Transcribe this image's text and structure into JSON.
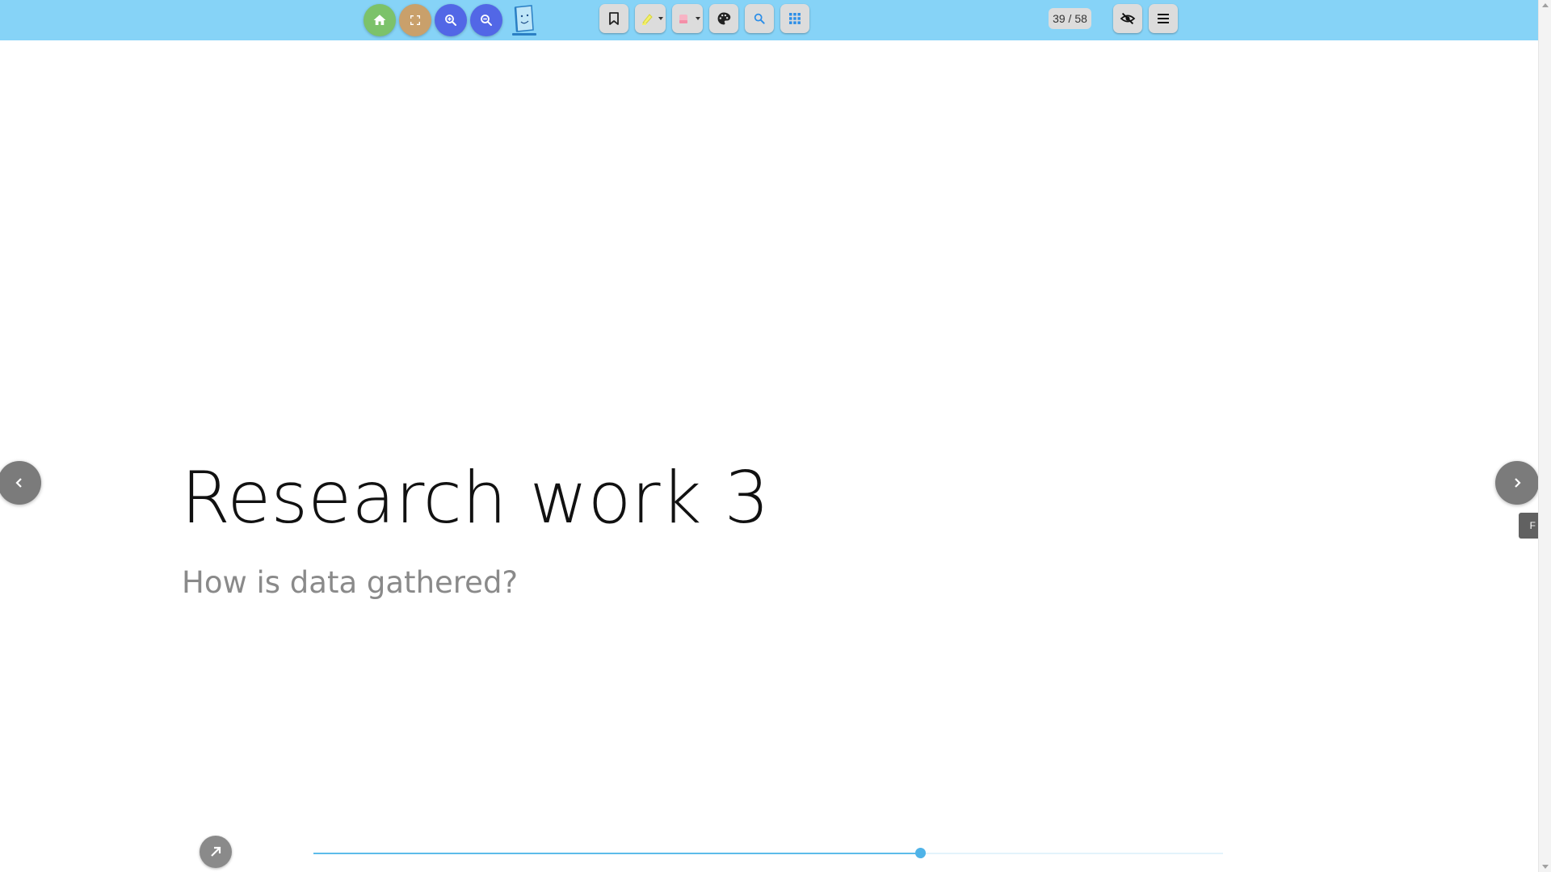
{
  "toolbar": {
    "page_indicator": "39 / 58",
    "colors": {
      "bar": "#86d3f7",
      "home": "#7cc26a",
      "fullscreen": "#c9a06b",
      "zoom": "#5267e6"
    },
    "icons": [
      "home-icon",
      "fullscreen-icon",
      "zoom-in-icon",
      "zoom-out-icon",
      "app-logo-icon",
      "bookmark-icon",
      "highlighter-icon",
      "eraser-icon",
      "palette-icon",
      "search-icon",
      "grid-icon",
      "hide-icon",
      "menu-icon"
    ]
  },
  "slide": {
    "title": "Research work 3",
    "subtitle": "How is data gathered?"
  },
  "side_tab": {
    "label": "F"
  },
  "progress": {
    "current_page": 39,
    "total_pages": 58
  }
}
